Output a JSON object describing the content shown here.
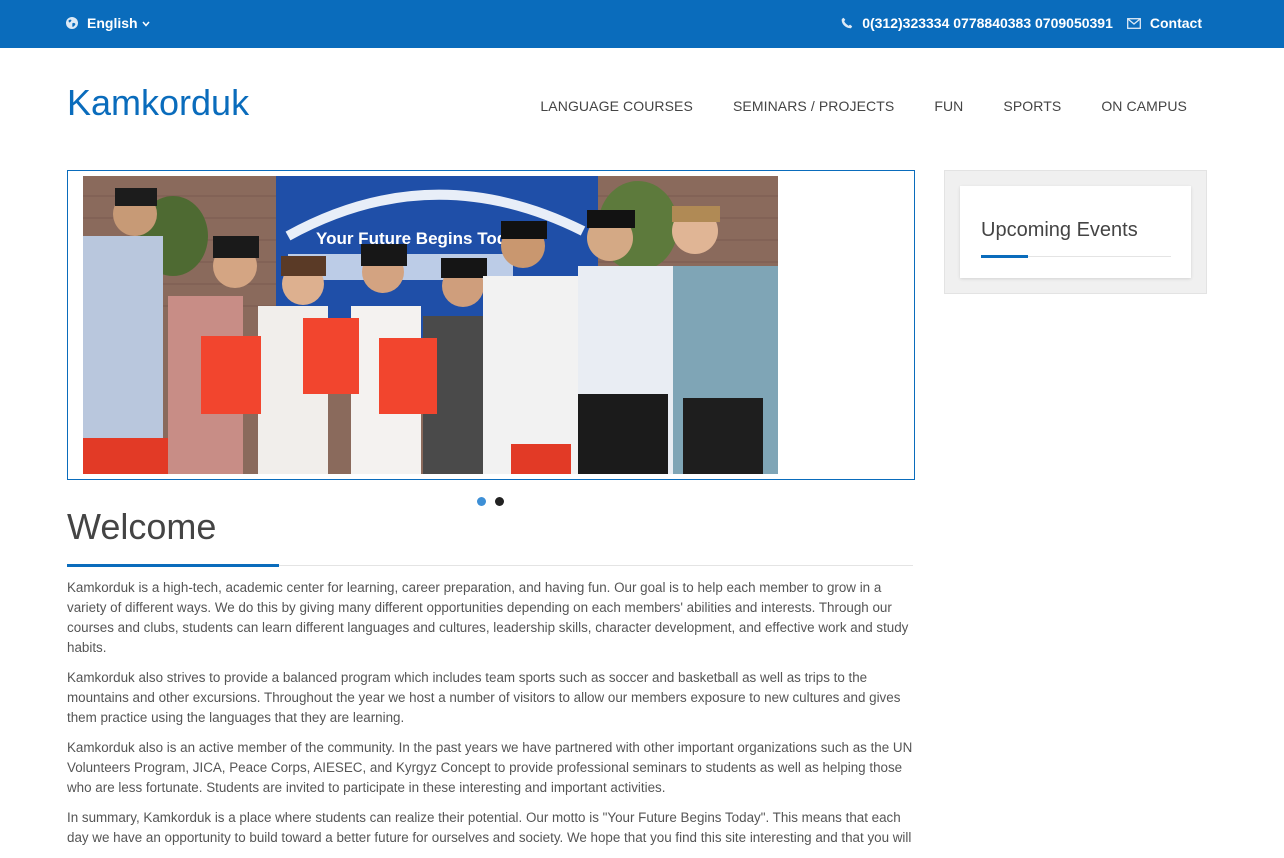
{
  "topbar": {
    "language": "English",
    "phones": "0(312)323334 0778840383 0709050391",
    "contact_label": "Contact",
    "background_color": "#0a6cbc",
    "icons": [
      "globe-icon",
      "chevron-down-icon",
      "phone-icon",
      "envelope-icon"
    ]
  },
  "header": {
    "logo": "Kamkorduk",
    "accent_color": "#0a6cbc",
    "nav": [
      {
        "label": "LANGUAGE COURSES"
      },
      {
        "label": "SEMINARS / PROJECTS"
      },
      {
        "label": "FUN"
      },
      {
        "label": "SPORTS"
      },
      {
        "label": "ON CAMPUS"
      }
    ]
  },
  "slider": {
    "banner_text": "Your Future Begins Tod",
    "slide_count": 2,
    "active_slide": 1
  },
  "welcome": {
    "title": "Welcome",
    "paragraphs": [
      "Kamkorduk is a high-tech, academic center for learning, career preparation, and having fun. Our goal is to help each member to grow in a variety of different ways. We do this by giving many different opportunities depending on each members' abilities and interests. Through our courses and clubs, students can learn different languages and cultures, leadership skills, character development, and effective work and study habits.",
      "Kamkorduk also strives to provide a balanced program which includes team sports such as soccer and basketball as well as trips to the mountains and other excursions. Throughout the year we host a number of visitors to allow our members exposure to new cultures and gives them practice using the languages that they are learning.",
      "Kamkorduk also is an active member of the community. In the past years we have partnered with other important organizations such as the UN Volunteers Program, JICA, Peace Corps, AIESEC, and Kyrgyz Concept to provide professional seminars to students as well as helping those who are less fortunate. Students are invited to participate in these interesting and important activities.",
      "In summary, Kamkorduk is a place where students can realize their potential. Our motto is \"Your Future Begins Today\". This means that each day we have an opportunity to build toward a better future for ourselves and society. We hope that you find this site interesting and that you will"
    ]
  },
  "sidebar": {
    "events_title": "Upcoming Events"
  }
}
